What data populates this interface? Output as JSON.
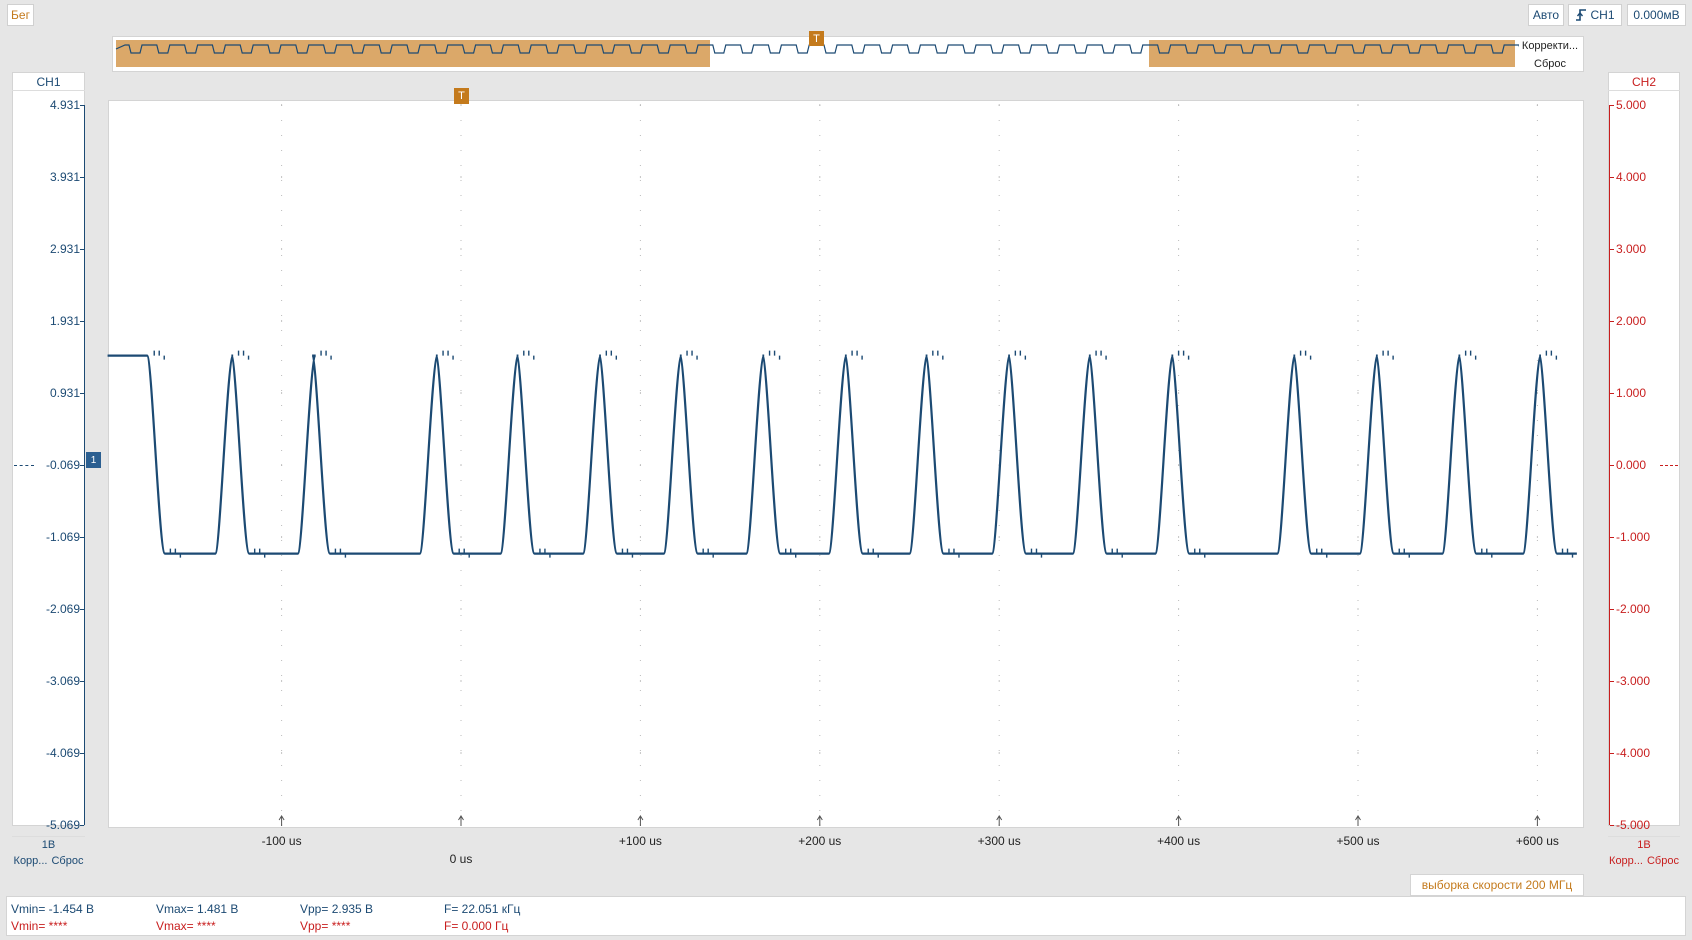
{
  "status": {
    "run_label": "Бег"
  },
  "top_right": {
    "mode": "Авто",
    "trigger_source": "CH1",
    "trigger_level": "0.000мВ"
  },
  "overview": {
    "adjust_label": "Корректи...",
    "reset_label": "Сброс",
    "trigger_marker": "T"
  },
  "plot": {
    "trigger_marker": "T",
    "zero_time_label": "0 us"
  },
  "ch1": {
    "name": "CH1",
    "scale": "1В",
    "adjust_label": "Корр...",
    "reset_label": "Сброс",
    "ground_marker": "1",
    "ticks": [
      "4.931",
      "3.931",
      "2.931",
      "1.931",
      "0.931",
      "-0.069",
      "-1.069",
      "-2.069",
      "-3.069",
      "-4.069",
      "-5.069"
    ]
  },
  "ch2": {
    "name": "CH2",
    "scale": "1В",
    "adjust_label": "Корр...",
    "reset_label": "Сброс",
    "ticks": [
      "5.000",
      "4.000",
      "3.000",
      "2.000",
      "1.000",
      "0.000",
      "-1.000",
      "-2.000",
      "-3.000",
      "-4.000",
      "-5.000"
    ]
  },
  "x_axis": {
    "ticks": [
      "-100 us",
      "+100 us",
      "+200 us",
      "+300 us",
      "+400 us",
      "+500 us",
      "+600 us"
    ]
  },
  "sample_rate": "выборка скорости 200 МГц",
  "measurements": {
    "ch1": {
      "vmin": "Vmin= -1.454 В",
      "vmax": "Vmax= 1.481 В",
      "vpp": "Vpp= 2.935 В",
      "freq": "F= 22.051 кГц"
    },
    "ch2": {
      "vmin": "Vmin= ****",
      "vmax": "Vmax= ****",
      "vpp": "Vpp= ****",
      "freq": "F= 0.000 Гц"
    }
  },
  "colors": {
    "ch1": "#1c4a73",
    "ch2": "#c81e1e",
    "accent": "#c47a1c",
    "overview_fill": "#dba869"
  },
  "chart_data": {
    "type": "line",
    "title": "",
    "xlabel": "",
    "ylabel": "",
    "x_unit": "us",
    "xlim": [
      -197,
      622
    ],
    "ylim": [
      -5.069,
      4.931
    ],
    "x_ticks": [
      -100,
      0,
      100,
      200,
      300,
      400,
      500,
      600
    ],
    "y_ticks": [
      4.931,
      3.931,
      2.931,
      1.931,
      0.931,
      -0.069,
      -1.069,
      -2.069,
      -3.069,
      -4.069,
      -5.069
    ],
    "grid": true,
    "series": [
      {
        "name": "CH1",
        "high": 1.45,
        "low": -1.3,
        "rising_edges_us": [
          -184,
          -137,
          -91,
          -23,
          22,
          68,
          113,
          159,
          205,
          250,
          296,
          341,
          387,
          455,
          501,
          547,
          592
        ],
        "falling_edges_us": [
          -175,
          -128,
          -83,
          -14,
          31,
          77,
          122,
          168,
          214,
          259,
          305,
          350,
          396,
          464,
          510,
          556,
          601
        ]
      }
    ]
  }
}
